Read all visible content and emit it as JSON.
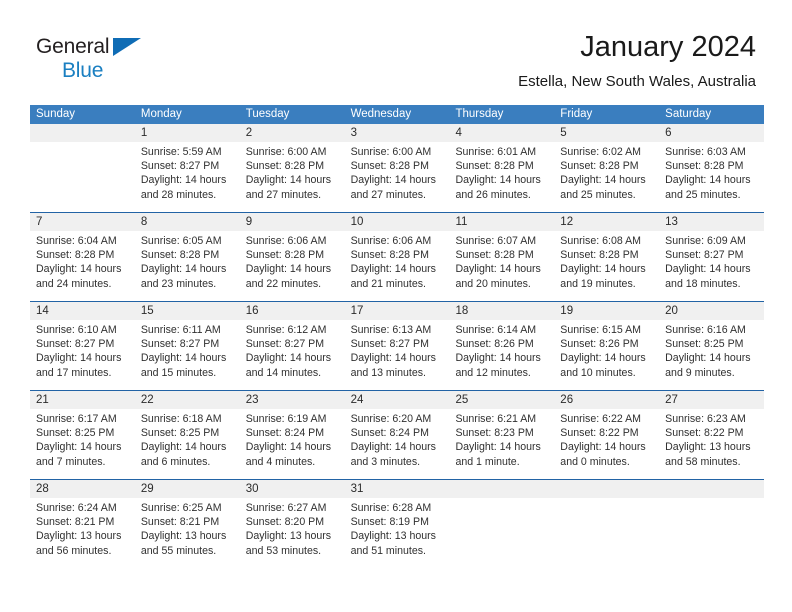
{
  "brand": {
    "word1": "General",
    "word2": "Blue",
    "accent_color": "#0f6cb5",
    "accent_color_2": "#1a7fc1"
  },
  "header": {
    "title": "January 2024",
    "subtitle": "Estella, New South Wales, Australia"
  },
  "calendar": {
    "header_bg": "#3a7ebf",
    "date_strip_bg": "#f0f0f0",
    "rule_color": "#2263a5",
    "weekday_headers": [
      "Sunday",
      "Monday",
      "Tuesday",
      "Wednesday",
      "Thursday",
      "Friday",
      "Saturday"
    ],
    "weeks": [
      [
        {
          "date": "",
          "lines": []
        },
        {
          "date": "1",
          "lines": [
            "Sunrise: 5:59 AM",
            "Sunset: 8:27 PM",
            "Daylight: 14 hours",
            "and 28 minutes."
          ]
        },
        {
          "date": "2",
          "lines": [
            "Sunrise: 6:00 AM",
            "Sunset: 8:28 PM",
            "Daylight: 14 hours",
            "and 27 minutes."
          ]
        },
        {
          "date": "3",
          "lines": [
            "Sunrise: 6:00 AM",
            "Sunset: 8:28 PM",
            "Daylight: 14 hours",
            "and 27 minutes."
          ]
        },
        {
          "date": "4",
          "lines": [
            "Sunrise: 6:01 AM",
            "Sunset: 8:28 PM",
            "Daylight: 14 hours",
            "and 26 minutes."
          ]
        },
        {
          "date": "5",
          "lines": [
            "Sunrise: 6:02 AM",
            "Sunset: 8:28 PM",
            "Daylight: 14 hours",
            "and 25 minutes."
          ]
        },
        {
          "date": "6",
          "lines": [
            "Sunrise: 6:03 AM",
            "Sunset: 8:28 PM",
            "Daylight: 14 hours",
            "and 25 minutes."
          ]
        }
      ],
      [
        {
          "date": "7",
          "lines": [
            "Sunrise: 6:04 AM",
            "Sunset: 8:28 PM",
            "Daylight: 14 hours",
            "and 24 minutes."
          ]
        },
        {
          "date": "8",
          "lines": [
            "Sunrise: 6:05 AM",
            "Sunset: 8:28 PM",
            "Daylight: 14 hours",
            "and 23 minutes."
          ]
        },
        {
          "date": "9",
          "lines": [
            "Sunrise: 6:06 AM",
            "Sunset: 8:28 PM",
            "Daylight: 14 hours",
            "and 22 minutes."
          ]
        },
        {
          "date": "10",
          "lines": [
            "Sunrise: 6:06 AM",
            "Sunset: 8:28 PM",
            "Daylight: 14 hours",
            "and 21 minutes."
          ]
        },
        {
          "date": "11",
          "lines": [
            "Sunrise: 6:07 AM",
            "Sunset: 8:28 PM",
            "Daylight: 14 hours",
            "and 20 minutes."
          ]
        },
        {
          "date": "12",
          "lines": [
            "Sunrise: 6:08 AM",
            "Sunset: 8:28 PM",
            "Daylight: 14 hours",
            "and 19 minutes."
          ]
        },
        {
          "date": "13",
          "lines": [
            "Sunrise: 6:09 AM",
            "Sunset: 8:27 PM",
            "Daylight: 14 hours",
            "and 18 minutes."
          ]
        }
      ],
      [
        {
          "date": "14",
          "lines": [
            "Sunrise: 6:10 AM",
            "Sunset: 8:27 PM",
            "Daylight: 14 hours",
            "and 17 minutes."
          ]
        },
        {
          "date": "15",
          "lines": [
            "Sunrise: 6:11 AM",
            "Sunset: 8:27 PM",
            "Daylight: 14 hours",
            "and 15 minutes."
          ]
        },
        {
          "date": "16",
          "lines": [
            "Sunrise: 6:12 AM",
            "Sunset: 8:27 PM",
            "Daylight: 14 hours",
            "and 14 minutes."
          ]
        },
        {
          "date": "17",
          "lines": [
            "Sunrise: 6:13 AM",
            "Sunset: 8:27 PM",
            "Daylight: 14 hours",
            "and 13 minutes."
          ]
        },
        {
          "date": "18",
          "lines": [
            "Sunrise: 6:14 AM",
            "Sunset: 8:26 PM",
            "Daylight: 14 hours",
            "and 12 minutes."
          ]
        },
        {
          "date": "19",
          "lines": [
            "Sunrise: 6:15 AM",
            "Sunset: 8:26 PM",
            "Daylight: 14 hours",
            "and 10 minutes."
          ]
        },
        {
          "date": "20",
          "lines": [
            "Sunrise: 6:16 AM",
            "Sunset: 8:25 PM",
            "Daylight: 14 hours",
            "and 9 minutes."
          ]
        }
      ],
      [
        {
          "date": "21",
          "lines": [
            "Sunrise: 6:17 AM",
            "Sunset: 8:25 PM",
            "Daylight: 14 hours",
            "and 7 minutes."
          ]
        },
        {
          "date": "22",
          "lines": [
            "Sunrise: 6:18 AM",
            "Sunset: 8:25 PM",
            "Daylight: 14 hours",
            "and 6 minutes."
          ]
        },
        {
          "date": "23",
          "lines": [
            "Sunrise: 6:19 AM",
            "Sunset: 8:24 PM",
            "Daylight: 14 hours",
            "and 4 minutes."
          ]
        },
        {
          "date": "24",
          "lines": [
            "Sunrise: 6:20 AM",
            "Sunset: 8:24 PM",
            "Daylight: 14 hours",
            "and 3 minutes."
          ]
        },
        {
          "date": "25",
          "lines": [
            "Sunrise: 6:21 AM",
            "Sunset: 8:23 PM",
            "Daylight: 14 hours",
            "and 1 minute."
          ]
        },
        {
          "date": "26",
          "lines": [
            "Sunrise: 6:22 AM",
            "Sunset: 8:22 PM",
            "Daylight: 14 hours",
            "and 0 minutes."
          ]
        },
        {
          "date": "27",
          "lines": [
            "Sunrise: 6:23 AM",
            "Sunset: 8:22 PM",
            "Daylight: 13 hours",
            "and 58 minutes."
          ]
        }
      ],
      [
        {
          "date": "28",
          "lines": [
            "Sunrise: 6:24 AM",
            "Sunset: 8:21 PM",
            "Daylight: 13 hours",
            "and 56 minutes."
          ]
        },
        {
          "date": "29",
          "lines": [
            "Sunrise: 6:25 AM",
            "Sunset: 8:21 PM",
            "Daylight: 13 hours",
            "and 55 minutes."
          ]
        },
        {
          "date": "30",
          "lines": [
            "Sunrise: 6:27 AM",
            "Sunset: 8:20 PM",
            "Daylight: 13 hours",
            "and 53 minutes."
          ]
        },
        {
          "date": "31",
          "lines": [
            "Sunrise: 6:28 AM",
            "Sunset: 8:19 PM",
            "Daylight: 13 hours",
            "and 51 minutes."
          ]
        },
        {
          "date": "",
          "lines": []
        },
        {
          "date": "",
          "lines": []
        },
        {
          "date": "",
          "lines": []
        }
      ]
    ]
  }
}
